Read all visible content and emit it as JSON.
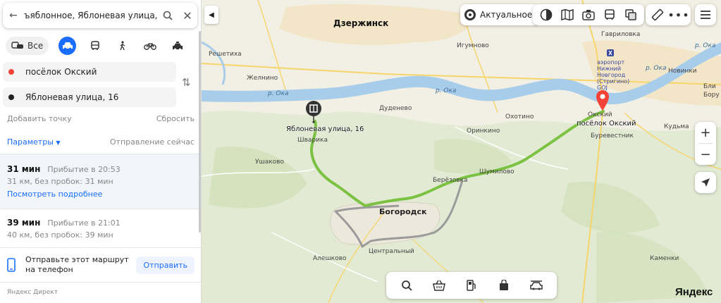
{
  "sidebar": {
    "search_query": "ъяблонное, Яблоневая улица, 16",
    "modes": {
      "all_label": "Все"
    },
    "from": "посёлок Окский",
    "to": "Яблоневая улица, 16",
    "add_point": "Добавить точку",
    "reset": "Сбросить",
    "params": "Параметры",
    "departure": "Отправление сейчас",
    "routes": [
      {
        "time": "31 мин",
        "arrival": "Прибытие в 20:53",
        "details": "31 км, без пробок: 31 мин",
        "more": "Посмотреть подробнее"
      },
      {
        "time": "39 мин",
        "arrival": "Прибытие в 21:01",
        "details": "40 км, без пробок: 39 мин"
      }
    ],
    "send_text_1": "Отправьте этот маршрут",
    "send_text_2": "на телефон",
    "send_button": "Отправить",
    "ad_label": "Яндекс Директ"
  },
  "map": {
    "actual_label": "Актуальное",
    "logo": "Яндекс",
    "places": {
      "dzerzhinsk": "Дзержинск",
      "gavrilovka": "Гавриловка",
      "igumnovo": "Игумново",
      "reshetikha": "Решетиха",
      "zhelnino": "Желнино",
      "oka1": "р. Ока",
      "oka2": "р. Ока",
      "oka3": "р. Ока",
      "oka4": "р. Ока",
      "airport_1": "аэропорт",
      "airport_2": "Нижний",
      "airport_3": "Новгород",
      "airport_4": "(Стригино)",
      "airport_5": "GOJ",
      "novinki": "Новинки",
      "dudenevo": "Дуденево",
      "okhotino": "Охотино",
      "orinkino": "Оринкино",
      "kudma": "Кудьма",
      "burevestnik": "Буревестник",
      "shvarikha": "Шварика",
      "ushakovo": "Ушаково",
      "shumilovo": "Шумилово",
      "berezovka": "Берёзовка",
      "bogorodsk": "Богородск",
      "centralny": "Центральный",
      "aleshkovo": "Алешково",
      "kamenki": "Каменки",
      "oksky_small": "Окский",
      "blin": "Бли",
      "bor": "Бору",
      "dest_label": "Яблоневая улица, 16",
      "start_label": "посёлок Окский"
    }
  },
  "colors": {
    "accent": "#1a6dff",
    "route_main": "#7cc242",
    "route_alt": "#9b9b9b",
    "river": "#a8cdea",
    "start_pin": "#f44336"
  }
}
